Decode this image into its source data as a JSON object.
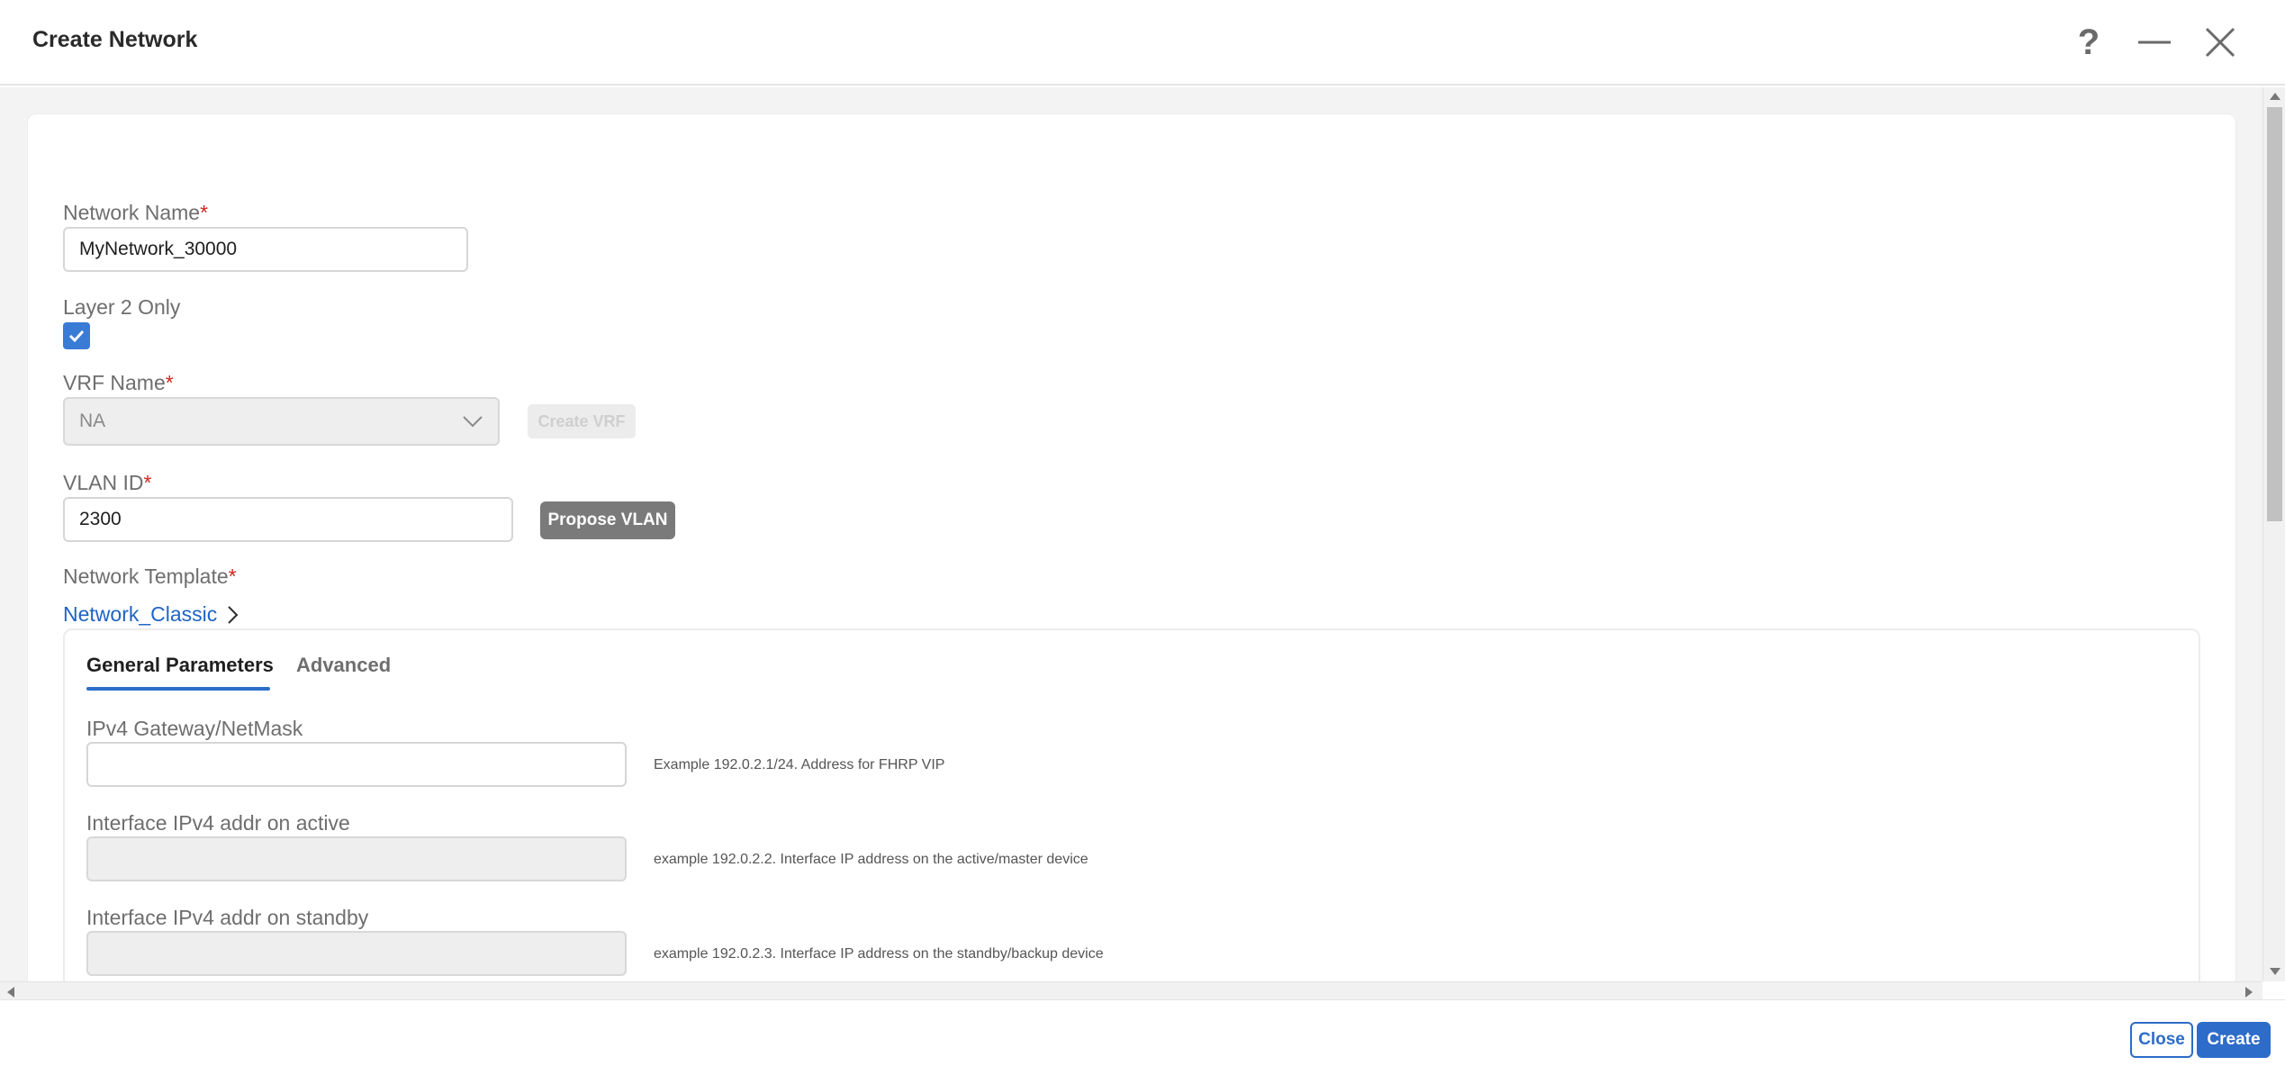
{
  "header": {
    "title": "Create Network"
  },
  "form": {
    "network_name": {
      "label": "Network Name",
      "required_mark": "*",
      "value": "MyNetwork_30000"
    },
    "layer2": {
      "label": "Layer 2 Only",
      "checked": true
    },
    "vrf": {
      "label": "VRF Name",
      "required_mark": "*",
      "value": "NA",
      "create_button": "Create VRF"
    },
    "vlan": {
      "label": "VLAN ID",
      "required_mark": "*",
      "value": "2300",
      "propose_button": "Propose VLAN"
    },
    "template": {
      "label": "Network Template",
      "required_mark": "*",
      "value": "Network_Classic"
    }
  },
  "tabs": [
    {
      "label": "General Parameters",
      "active": true
    },
    {
      "label": "Advanced",
      "active": false
    }
  ],
  "general": {
    "fields": [
      {
        "label": "IPv4 Gateway/NetMask",
        "value": "",
        "hint": "Example 192.0.2.1/24. Address for FHRP VIP",
        "disabled": false
      },
      {
        "label": "Interface IPv4 addr on active",
        "value": "",
        "hint": "example 192.0.2.2. Interface IP address on the active/master device",
        "disabled": true
      },
      {
        "label": "Interface IPv4 addr on standby",
        "value": "",
        "hint": "example 192.0.2.3. Interface IP address on the standby/backup device",
        "disabled": true
      }
    ]
  },
  "footer": {
    "close_label": "Close",
    "create_label": "Create"
  },
  "colors": {
    "accent": "#2d6cc8",
    "required": "#d0271d",
    "link": "#1f64c4"
  },
  "icons": [
    "help-icon",
    "minimize-icon",
    "close-icon",
    "checkmark-icon",
    "chevron-down-icon",
    "chevron-right-icon"
  ]
}
